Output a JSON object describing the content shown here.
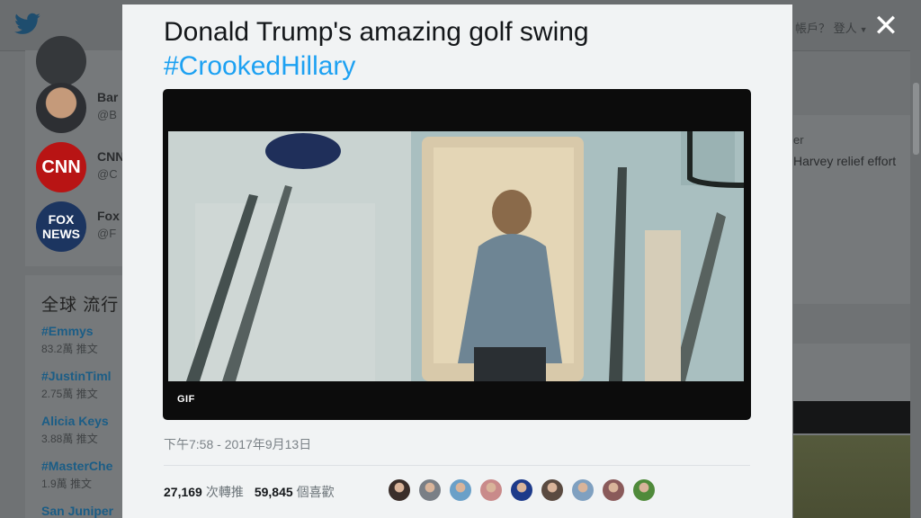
{
  "background": {
    "lang_menu": "帳戶？ 登人",
    "suggested_accounts": [
      {
        "name": "Bar",
        "handle": "@B",
        "avatar_color": "#d9b79a"
      },
      {
        "name": "CNN",
        "handle": "@C",
        "avatar_color": "#c31617"
      },
      {
        "name": "Fox",
        "handle": "@F",
        "avatar_color": "#1f3a67"
      }
    ],
    "trends_title": "全球 流行",
    "trends": [
      {
        "name": "#Emmys",
        "count": "83.2萬 推文"
      },
      {
        "name": "#JustinTiml",
        "count": "2.75萬 推文"
      },
      {
        "name": "Alicia Keys",
        "count": "3.88萬 推文"
      },
      {
        "name": "#MasterChe",
        "count": "1.9萬 推文"
      },
      {
        "name": "San Juniper",
        "count": ""
      }
    ],
    "right_text_1": "er",
    "right_text_2": "Harvey relief effort"
  },
  "tweet": {
    "title": "Donald Trump's amazing golf swing",
    "hashtag": "#CrookedHillary",
    "media_badge": "GIF",
    "timestamp": "下午7:58 - 2017年9月13日",
    "retweets": {
      "count": "27,169",
      "label": "次轉推"
    },
    "likes": {
      "count": "59,845",
      "label": "個喜歡"
    },
    "liker_colors": [
      "#3a2e2a",
      "#7a7f86",
      "#6aa0c8",
      "#c98a8a",
      "#1d3a8a",
      "#5a4a40",
      "#7fa0c0",
      "#8a5a5a",
      "#4f8a3a"
    ]
  },
  "colors": {
    "link": "#1da1f2",
    "modal_bg": "#f1f3f4",
    "overlay": "#6f7274"
  }
}
